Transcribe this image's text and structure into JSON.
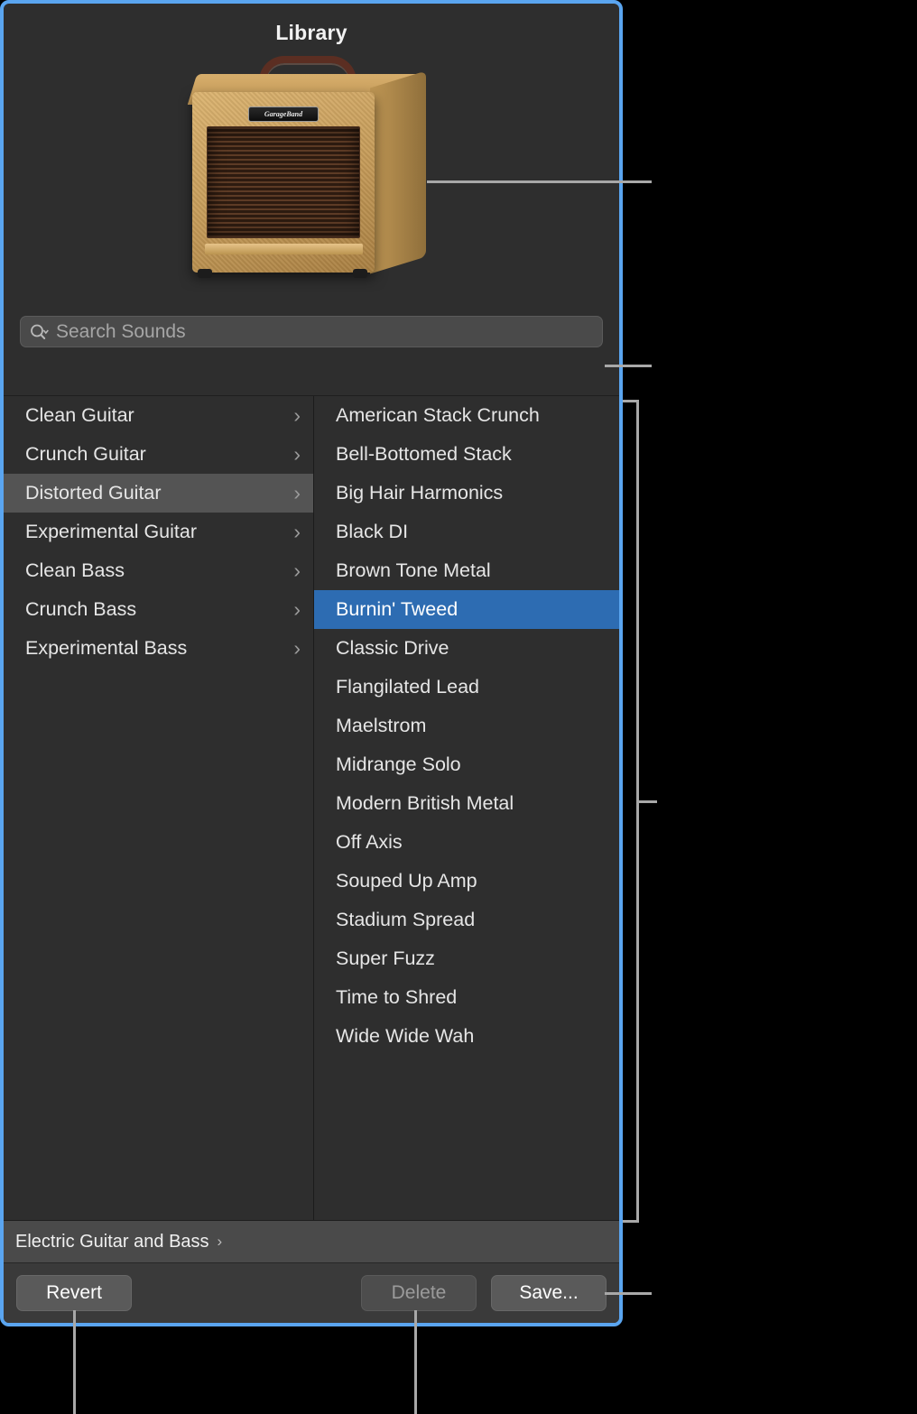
{
  "window": {
    "title": "Library",
    "focus_color": "#5aa5f0",
    "background": "#2e2e2e"
  },
  "artwork": {
    "name": "tweed-guitar-amp",
    "badge_text": "GarageBand"
  },
  "search": {
    "icon": "search-icon",
    "dropdown_icon": "chevron-down-icon",
    "placeholder": "Search Sounds",
    "value": ""
  },
  "categories": {
    "selected_index": 2,
    "items": [
      {
        "label": "Clean Guitar",
        "chevron": "›"
      },
      {
        "label": "Crunch Guitar",
        "chevron": "›"
      },
      {
        "label": "Distorted Guitar",
        "chevron": "›"
      },
      {
        "label": "Experimental Guitar",
        "chevron": "›"
      },
      {
        "label": "Clean Bass",
        "chevron": "›"
      },
      {
        "label": "Crunch Bass",
        "chevron": "›"
      },
      {
        "label": "Experimental Bass",
        "chevron": "›"
      }
    ]
  },
  "presets": {
    "selected_index": 5,
    "selection_color": "#2d6cb2",
    "items": [
      {
        "label": "American Stack Crunch"
      },
      {
        "label": "Bell-Bottomed Stack"
      },
      {
        "label": "Big Hair Harmonics"
      },
      {
        "label": "Black DI"
      },
      {
        "label": "Brown Tone Metal"
      },
      {
        "label": "Burnin' Tweed"
      },
      {
        "label": "Classic Drive"
      },
      {
        "label": "Flangilated Lead"
      },
      {
        "label": "Maelstrom"
      },
      {
        "label": "Midrange Solo"
      },
      {
        "label": "Modern British Metal"
      },
      {
        "label": "Off Axis"
      },
      {
        "label": "Souped Up Amp"
      },
      {
        "label": "Stadium Spread"
      },
      {
        "label": "Super Fuzz"
      },
      {
        "label": "Time to Shred"
      },
      {
        "label": "Wide Wide Wah"
      }
    ]
  },
  "breadcrumb": {
    "label": "Electric Guitar and Bass",
    "chevron": "›"
  },
  "footer": {
    "revert_label": "Revert",
    "delete_label": "Delete",
    "delete_disabled": true,
    "save_label": "Save..."
  }
}
